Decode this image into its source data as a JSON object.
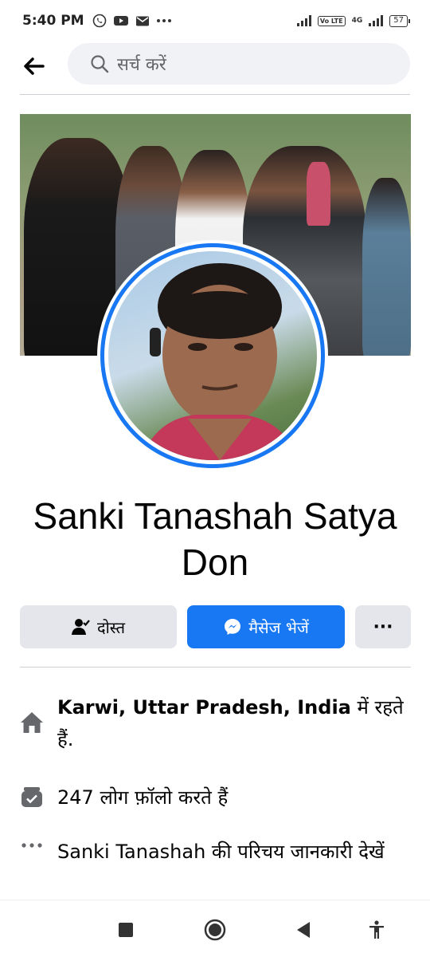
{
  "status_bar": {
    "time": "5:40 PM",
    "left_icons": [
      "whatsapp-icon",
      "youtube-icon",
      "mail-icon",
      "more-dots-icon"
    ],
    "volte_label": "Vo LTE",
    "network_label": "4G",
    "battery_level": "57"
  },
  "header": {
    "back_icon": "back-arrow-icon",
    "search_icon": "search-icon",
    "search_placeholder": "सर्च करें"
  },
  "profile": {
    "name": "Sanki Tanashah Satya Don"
  },
  "actions": {
    "friends_label": "दोस्त",
    "message_label": "मैसेज भेजें",
    "more_label": "···"
  },
  "info": {
    "location_bold": "Karwi, Uttar Pradesh, India",
    "location_suffix": " में रहते हैं.",
    "followers": "247 लोग फ़ॉलो करते हैं",
    "about_link": "Sanki Tanashah की परिचय जानकारी देखें"
  },
  "colors": {
    "accent": "#1877f2",
    "button_gray": "#e4e6eb",
    "search_bg": "#f0f2f5",
    "icon_gray": "#65676b"
  }
}
